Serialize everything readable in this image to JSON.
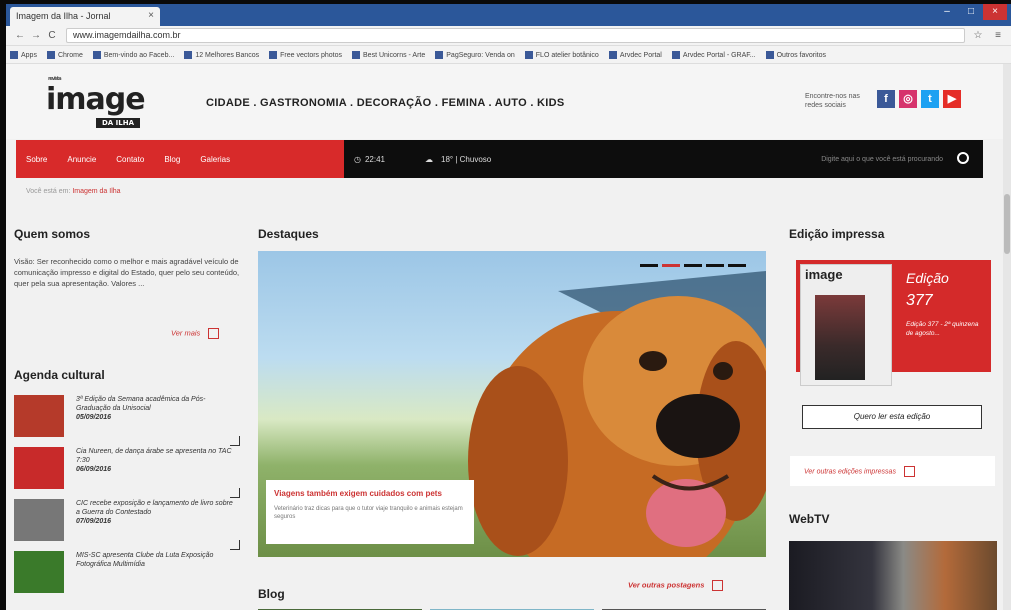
{
  "browser": {
    "tab_title": "Imagem da Ilha - Jornal",
    "url": "www.imagemdailha.com.br",
    "bookmarks": [
      "Apps",
      "Chrome",
      "Bem-vindo ao Faceb...",
      "12 Melhores Bancos",
      "Free vectors photos",
      "Best Unicorns - Arte",
      "PagSeguro: Venda on",
      "FLO atelier botânico",
      "Arvdec Portal",
      "Arvdec Portal - GRAF...",
      "Outros favoritos"
    ]
  },
  "header": {
    "logo_top": "revista",
    "logo_text": "image",
    "logo_sub": "DA ILHA",
    "nav": "CIDADE . GASTRONOMIA . DECORAÇÃO . FEMINA . AUTO . KIDS",
    "social_text": "Encontre-nos nas redes sociais",
    "social": [
      {
        "icon": "facebook-icon",
        "glyph": "f",
        "color": "#3b5998"
      },
      {
        "icon": "instagram-icon",
        "glyph": "◎",
        "color": "#d6336c"
      },
      {
        "icon": "twitter-icon",
        "glyph": "t",
        "color": "#1da1f2"
      },
      {
        "icon": "youtube-icon",
        "glyph": "▶",
        "color": "#e52d27"
      }
    ]
  },
  "menu": {
    "items": [
      "Sobre",
      "Anuncie",
      "Contato",
      "Blog",
      "Galerias"
    ],
    "time": "22:41",
    "weather": "18° | Chuvoso",
    "search_placeholder": "Digite aqui o que você está procurando"
  },
  "breadcrumb": {
    "prefix": "Você está em:",
    "current": "Imagem da Ilha"
  },
  "about": {
    "title": "Quem somos",
    "text": "Visão: Ser reconhecido como o melhor e mais agradável veículo de comunicação impresso e digital do Estado, quer pelo seu conteúdo, quer pela sua apresentação. Valores ...",
    "more": "Ver mais"
  },
  "agenda": {
    "title": "Agenda cultural",
    "items": [
      {
        "text": "3ª Edição da Semana acadêmica da Pós-Graduação da Unisocial",
        "date": "05/09/2016",
        "color": "#b53a2a"
      },
      {
        "text": "Cia Nureen, de dança árabe se apresenta no TAC 7:30",
        "date": "06/09/2016",
        "color": "#c82a2a"
      },
      {
        "text": "CIC recebe exposição e lançamento de livro sobre a Guerra do Contestado",
        "date": "07/09/2016",
        "color": "#777777"
      },
      {
        "text": "MIS-SC apresenta Clube da Luta Exposição Fotográfica Multimídia",
        "date": "",
        "color": "#3a7a2a"
      }
    ]
  },
  "highlights": {
    "title": "Destaques",
    "caption_title": "Viagens também exigem cuidados com pets",
    "caption_text": "Veterinário traz dicas para que o tutor viaje tranquilo e animais estejam seguros"
  },
  "blog": {
    "title": "Blog",
    "more": "Ver outras postagens"
  },
  "print_edition": {
    "title": "Edição impressa",
    "cover_mast": "image",
    "label": "Edição",
    "number": "377",
    "desc": "Edição 377 - 2ª quinzena de agosto...",
    "read_button": "Quero ler esta edição",
    "other": "Ver outras edições impressas"
  },
  "webtv": {
    "title": "WebTV"
  }
}
